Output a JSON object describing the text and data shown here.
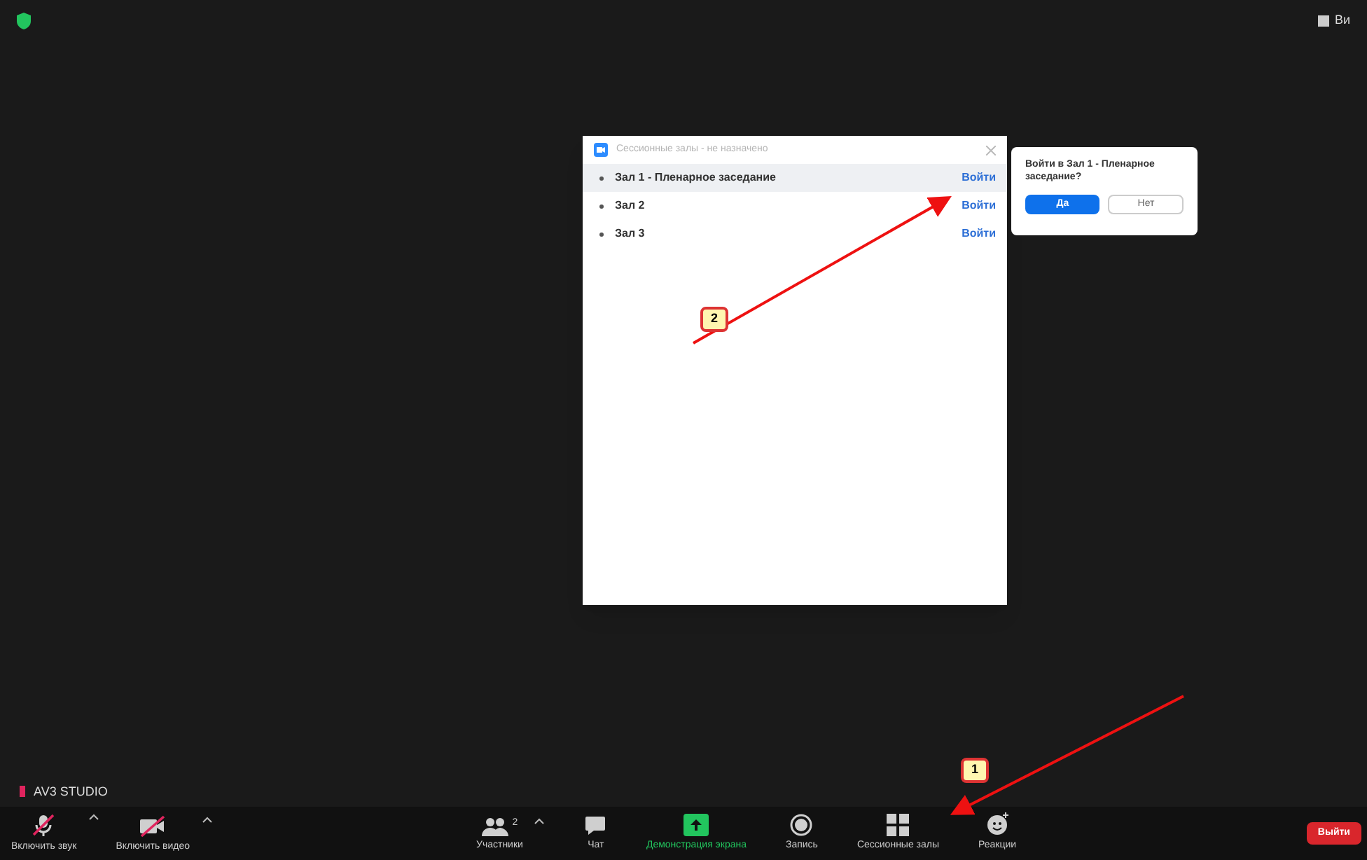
{
  "top_bar": {
    "view_label": "Ви"
  },
  "dialog": {
    "title": "Сессионные залы - не назначено",
    "rooms": [
      {
        "name": "Зал 1 - Пленарное заседание",
        "join": "Войти",
        "highlighted": true
      },
      {
        "name": "Зал 2",
        "join": "Войти",
        "highlighted": false
      },
      {
        "name": "Зал 3",
        "join": "Войти",
        "highlighted": false
      }
    ]
  },
  "confirm_popup": {
    "question": "Войти в Зал 1 - Пленарное заседание?",
    "yes": "Да",
    "no": "Нет"
  },
  "name_tag": "AV3 STUDIO",
  "toolbar": {
    "left": [
      {
        "kind": "mic",
        "label": "Включить звук",
        "muted": true
      },
      {
        "kind": "video",
        "label": "Включить видео",
        "muted": true
      }
    ],
    "center": [
      {
        "kind": "participants",
        "label": "Участники",
        "count": "2",
        "active": false
      },
      {
        "kind": "chat",
        "label": "Чат",
        "active": false
      },
      {
        "kind": "share",
        "label": "Демонстрация экрана",
        "active": true
      },
      {
        "kind": "record",
        "label": "Запись",
        "active": false
      },
      {
        "kind": "rooms",
        "label": "Сессионные залы",
        "active": false
      },
      {
        "kind": "reactions",
        "label": "Реакции",
        "active": false
      }
    ],
    "leave": "Выйти"
  },
  "annotations": [
    {
      "label": "1"
    },
    {
      "label": "2"
    }
  ]
}
